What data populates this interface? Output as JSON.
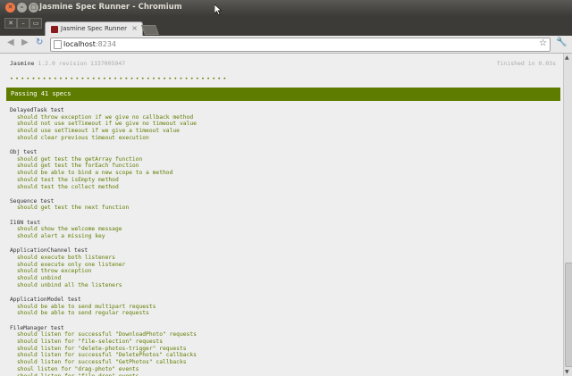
{
  "window": {
    "title": "Jasmine Spec Runner - Chromium"
  },
  "tabs": [
    {
      "label": "Jasmine Spec Runner",
      "close": "×"
    }
  ],
  "toolbar": {
    "url_host": "localhost",
    "url_port": ":8234"
  },
  "icons": {
    "back": "back-arrow-icon",
    "forward": "forward-arrow-icon",
    "reload": "reload-icon",
    "page": "page-icon",
    "bookmark": "star-icon",
    "wrench": "wrench-icon"
  },
  "jasmine": {
    "name": "Jasmine",
    "version": "1.2.0 revision 1337005947",
    "finished": "finished in 0.03s",
    "dots": "••••••••••••••••••••••••••••••••••••••••",
    "passing": "Passing 41 specs"
  },
  "colors": {
    "pass": "#5e7d00",
    "background": "#eeeeee"
  },
  "suites": [
    {
      "name": "DelayedTask test",
      "specs": [
        "should throw exception if we give no callback method",
        "should not use setTimeout if we give no timeout value",
        "should use setTimeout if we give a timeout value",
        "should clear previous timeout execution"
      ]
    },
    {
      "name": "Obj test",
      "specs": [
        "should get test the getArray function",
        "should get test the forEach function",
        "should be able to bind a new scope to a method",
        "should test the isEmpty method",
        "should test the collect method"
      ]
    },
    {
      "name": "Sequence test",
      "specs": [
        "should get test the next function"
      ]
    },
    {
      "name": "I18N test",
      "specs": [
        "should show the welcome message",
        "should alert a missing key"
      ]
    },
    {
      "name": "ApplicationChannel test",
      "specs": [
        "should execute both listeners",
        "should execute only one listener",
        "should throw exception",
        "should unbind",
        "should unbind all the listeners"
      ]
    },
    {
      "name": "ApplicationModel test",
      "specs": [
        "should be able to send multipart requests",
        "should be able to send regular requests"
      ]
    },
    {
      "name": "FileManager test",
      "specs": [
        "should listen for successful \"DownloadPhoto\" requests",
        "should listen for \"file-selection\" requests",
        "should listen for \"delete-photos-trigger\" requests",
        "should listen for successful \"DeletePhotos\" callbacks",
        "should listen for successful \"GetPhotos\" callbacks",
        "shoul listen for \"drag-photo\" events",
        "should listen for \"file-drop\" events"
      ]
    }
  ]
}
